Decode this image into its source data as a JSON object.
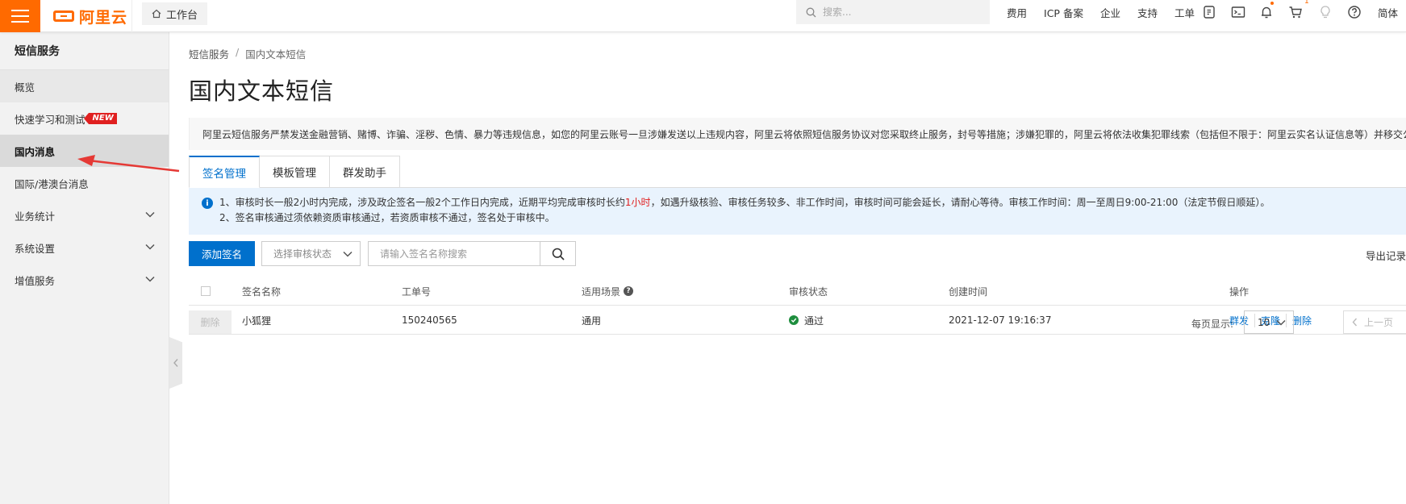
{
  "topbar": {
    "brand": "阿里云",
    "workbench": "工作台",
    "search_placeholder": "搜索...",
    "links": [
      "费用",
      "ICP 备案",
      "企业",
      "支持",
      "工单"
    ],
    "cart_count": "1",
    "lang": "简体"
  },
  "sidebar": {
    "title": "短信服务",
    "items": [
      {
        "label": "概览"
      },
      {
        "label": "快速学习和测试",
        "badge": "NEW"
      },
      {
        "label": "国内消息"
      },
      {
        "label": "国际/港澳台消息"
      },
      {
        "label": "业务统计"
      },
      {
        "label": "系统设置"
      },
      {
        "label": "增值服务"
      }
    ]
  },
  "breadcrumb": {
    "root": "短信服务",
    "sep": "/",
    "current": "国内文本短信"
  },
  "page_title": "国内文本短信",
  "notice": "阿里云短信服务严禁发送金融营销、赌博、诈骗、淫秽、色情、暴力等违规信息，如您的阿里云账号一旦涉嫌发送以上违规内容，阿里云将依照短信服务协议对您采取终止服务，封号等措施；涉嫌犯罪的，阿里云将依法收集犯罪线索（包括但不限于：阿里云实名认证信息等）并移交公",
  "tabs": [
    "签名管理",
    "模板管理",
    "群发助手"
  ],
  "info": {
    "line1_a": "1、审核时长一般2小时内完成，涉及政企签名一般2个工作日内完成，近期平均完成审核时长约",
    "line1_red": "1小时",
    "line1_b": "，如遇升级核验、审核任务较多、非工作时间，审核时间可能会延长，请耐心等待。审核工作时间：周一至周日9:00-21:00（法定节假日顺延）。",
    "line2": "2、签名审核通过须依赖资质审核通过，若资质审核不通过，签名处于审核中。"
  },
  "toolbar": {
    "add_button": "添加签名",
    "status_placeholder": "选择审核状态",
    "search_placeholder": "请输入签名名称搜索",
    "export": "导出记录"
  },
  "table": {
    "headers": {
      "name": "签名名称",
      "ticket": "工单号",
      "scene": "适用场景",
      "status": "审核状态",
      "created": "创建时间",
      "ops": "操作"
    },
    "rows": [
      {
        "name": "小狐狸",
        "ticket": "150240565",
        "scene": "通用",
        "status": "通过",
        "created": "2021-12-07 19:16:37",
        "ops": [
          "群发",
          "克隆",
          "删除"
        ]
      }
    ]
  },
  "footer": {
    "delete": "删除",
    "per_page_label": "每页显示:",
    "per_page_value": "10",
    "prev": "上一页"
  },
  "colors": {
    "brand": "#ff6a00",
    "primary": "#0070cc",
    "success": "#1e8e3e",
    "danger": "#e02020"
  }
}
